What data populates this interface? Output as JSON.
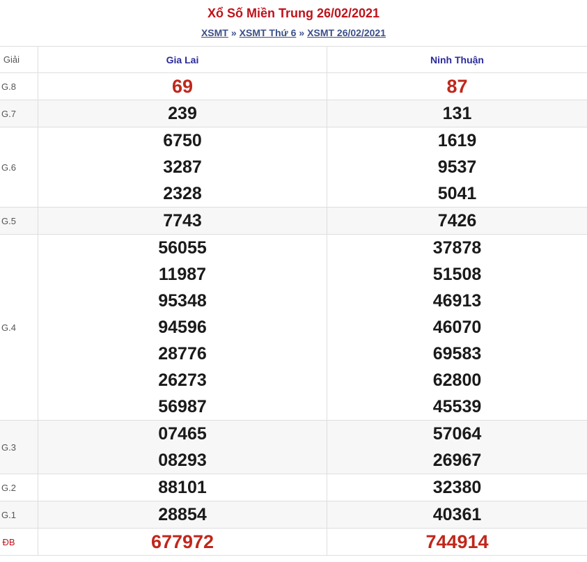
{
  "page": {
    "title": "Xổ Số Miền Trung 26/02/2021",
    "breadcrumb": [
      {
        "label": "XSMT"
      },
      {
        "label": "XSMT Thứ 6"
      },
      {
        "label": "XSMT 26/02/2021"
      }
    ],
    "separator": "»"
  },
  "table": {
    "col_prize": "Giải",
    "provinces": [
      "Gia Lai",
      "Ninh Thuận"
    ],
    "prizes": [
      {
        "label": "G.8",
        "gialai": [
          "69"
        ],
        "ninhthuan": [
          "87"
        ],
        "highlight": true
      },
      {
        "label": "G.7",
        "gialai": [
          "239"
        ],
        "ninhthuan": [
          "131"
        ]
      },
      {
        "label": "G.6",
        "gialai": [
          "6750",
          "3287",
          "2328"
        ],
        "ninhthuan": [
          "1619",
          "9537",
          "5041"
        ]
      },
      {
        "label": "G.5",
        "gialai": [
          "7743"
        ],
        "ninhthuan": [
          "7426"
        ]
      },
      {
        "label": "G.4",
        "gialai": [
          "56055",
          "11987",
          "95348",
          "94596",
          "28776",
          "26273",
          "56987"
        ],
        "ninhthuan": [
          "37878",
          "51508",
          "46913",
          "46070",
          "69583",
          "62800",
          "45539"
        ]
      },
      {
        "label": "G.3",
        "gialai": [
          "07465",
          "08293"
        ],
        "ninhthuan": [
          "57064",
          "26967"
        ]
      },
      {
        "label": "G.2",
        "gialai": [
          "88101"
        ],
        "ninhthuan": [
          "32380"
        ]
      },
      {
        "label": "G.1",
        "gialai": [
          "28854"
        ],
        "ninhthuan": [
          "40361"
        ]
      },
      {
        "label": "ĐB",
        "gialai": [
          "677972"
        ],
        "ninhthuan": [
          "744914"
        ],
        "highlight": true
      }
    ]
  },
  "colors": {
    "title": "#c0121b",
    "link": "#3b4f88",
    "header": "#2a2a9c",
    "highlight": "#c0271b"
  }
}
